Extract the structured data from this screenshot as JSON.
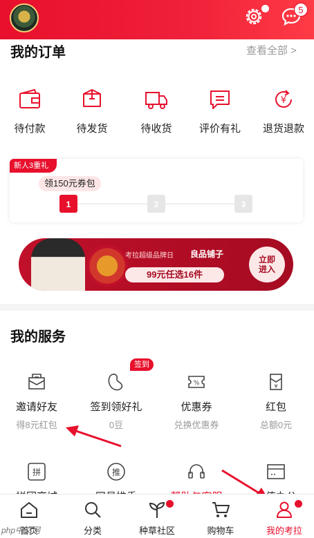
{
  "header": {
    "message_count": "5"
  },
  "orders": {
    "title": "我的订单",
    "see_all": "查看全部 >",
    "items": [
      {
        "label": "待付款",
        "icon": "wallet-icon"
      },
      {
        "label": "待发货",
        "icon": "box-icon"
      },
      {
        "label": "待收货",
        "icon": "truck-icon"
      },
      {
        "label": "评价有礼",
        "icon": "comment-icon"
      },
      {
        "label": "退货退款",
        "icon": "refund-icon"
      }
    ]
  },
  "newbie": {
    "tag": "新人3重礼",
    "coupon": "领150元券包",
    "steps": [
      "1",
      "2",
      "3"
    ]
  },
  "banner": {
    "tagline": "考拉超级品牌日",
    "brand": "良品铺子",
    "offer": "99元任选16件",
    "cta_line1": "立即",
    "cta_line2": "进入"
  },
  "services": {
    "title": "我的服务",
    "sign_badge": "签到",
    "row1": [
      {
        "name": "邀请好友",
        "sub": "得8元红包",
        "icon": "envelope-icon"
      },
      {
        "name": "签到领好礼",
        "sub": "0豆",
        "icon": "bean-icon"
      },
      {
        "name": "优惠券",
        "sub": "兑换优惠券",
        "icon": "coupon-icon"
      },
      {
        "name": "红包",
        "sub": "总额0元",
        "icon": "red-packet-icon"
      }
    ],
    "row2": [
      {
        "name": "拼团商城",
        "icon": "pin-icon"
      },
      {
        "name": "网易推手",
        "icon": "tui-icon"
      },
      {
        "name": "帮助与客服",
        "icon": "headset-icon"
      },
      {
        "name": "增值办公",
        "icon": "card-icon"
      }
    ]
  },
  "tabbar": {
    "items": [
      {
        "label": "首页",
        "icon": "home-icon"
      },
      {
        "label": "分类",
        "icon": "search-icon"
      },
      {
        "label": "种草社区",
        "icon": "sprout-icon"
      },
      {
        "label": "购物车",
        "icon": "cart-icon"
      },
      {
        "label": "我的考拉",
        "icon": "user-icon"
      }
    ]
  },
  "watermark": "php中文网",
  "colors": {
    "brand_red": "#e8102c",
    "muted_gray": "#999999"
  }
}
